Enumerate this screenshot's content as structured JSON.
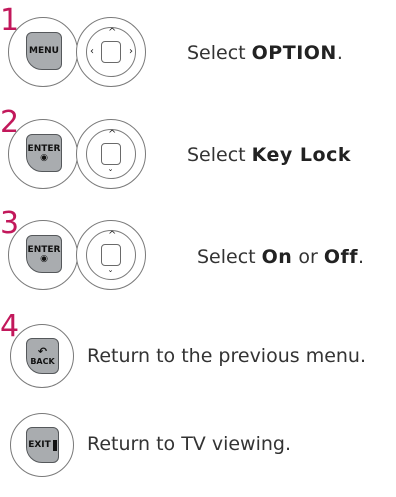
{
  "steps": [
    {
      "number": "1",
      "key": "MENU",
      "text_pre": "Select ",
      "text_bold": "OPTION",
      "text_post": "."
    },
    {
      "number": "2",
      "key": "ENTER",
      "text_pre": "Select ",
      "text_bold": "Key Lock",
      "text_post": ""
    },
    {
      "number": "3",
      "key": "ENTER",
      "text_pre": "Select ",
      "text_bold": "On",
      "text_mid": " or ",
      "text_bold2": "Off",
      "text_post": "."
    },
    {
      "number": "4",
      "key": "BACK",
      "text": "Return to the previous menu."
    }
  ],
  "exit_row": {
    "key": "EXIT",
    "text": "Return to TV viewing."
  },
  "colors": {
    "step_number": "#c2185b",
    "key_fill": "#a9acaf"
  },
  "icons": {
    "nav": "directional-pad-icon",
    "back": "back-arrow-icon",
    "exit": "exit-door-icon"
  }
}
